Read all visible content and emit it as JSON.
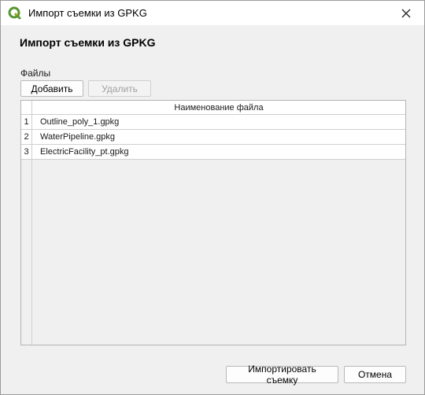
{
  "window": {
    "title": "Импорт съемки из GPKG",
    "app_icon": "qgis-logo-icon",
    "close_icon": "close-icon"
  },
  "dialog": {
    "heading": "Импорт съемки из GPKG",
    "files_label": "Файлы",
    "add_label": "Добавить",
    "delete_label": "Удалить",
    "import_label": "Импортировать съемку",
    "cancel_label": "Отмена"
  },
  "table": {
    "column_header": "Наименование файла",
    "rows": [
      {
        "num": "1",
        "name": "Outline_poly_1.gpkg"
      },
      {
        "num": "2",
        "name": "WaterPipeline.gpkg"
      },
      {
        "num": "3",
        "name": "ElectricFacility_pt.gpkg"
      }
    ]
  },
  "colors": {
    "qgis_green": "#589632",
    "qgis_yellow": "#f0b900"
  }
}
